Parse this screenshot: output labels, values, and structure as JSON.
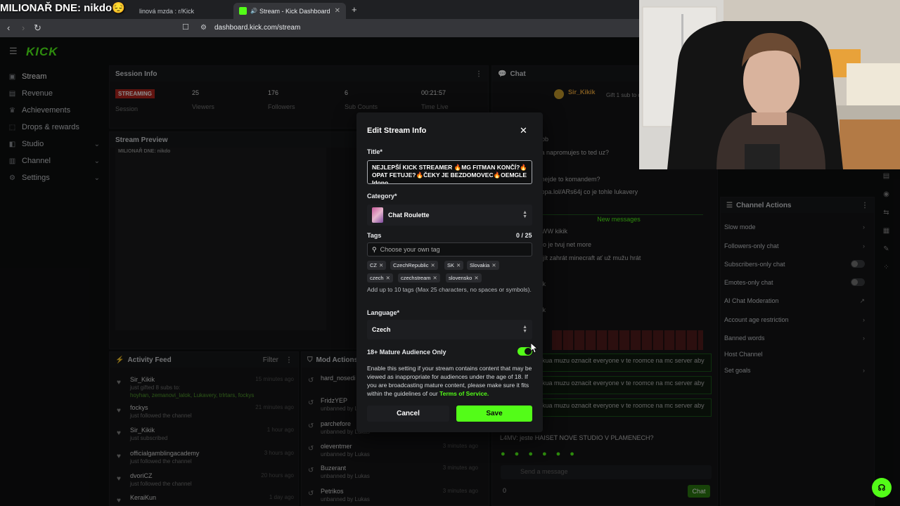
{
  "overlay_text": "MILIONAŘ DNE: nikdo😔",
  "browser": {
    "tabs": [
      {
        "label": "linová mzda : r/Kick",
        "active": false
      },
      {
        "label": "Stream - Kick Dashboard",
        "active": true
      }
    ],
    "new_tab": "+",
    "url": "dashboard.kick.com/stream"
  },
  "app": {
    "logo": "KICK",
    "nav": [
      {
        "label": "Stream",
        "icon": "stream-icon",
        "active": true,
        "expandable": false
      },
      {
        "label": "Revenue",
        "icon": "revenue-icon",
        "active": false,
        "expandable": false
      },
      {
        "label": "Achievements",
        "icon": "trophy-icon",
        "active": false,
        "expandable": false
      },
      {
        "label": "Drops & rewards",
        "icon": "gift-icon",
        "active": false,
        "expandable": false
      },
      {
        "label": "Studio",
        "icon": "studio-icon",
        "active": false,
        "expandable": true
      },
      {
        "label": "Channel",
        "icon": "channel-icon",
        "active": false,
        "expandable": true
      },
      {
        "label": "Settings",
        "icon": "gear-icon",
        "active": false,
        "expandable": true
      }
    ],
    "session_info": {
      "title": "Session Info",
      "badge": "STREAMING",
      "badge_label": "Session",
      "stats": [
        {
          "value": "25",
          "label": "Viewers"
        },
        {
          "value": "176",
          "label": "Followers"
        },
        {
          "value": "6",
          "label": "Sub Counts"
        },
        {
          "value": "00:21:57",
          "label": "Time Live"
        }
      ]
    },
    "stream_preview": {
      "title": "Stream Preview",
      "inner_title": "MILIONAŘ DNE: nikdo"
    },
    "activity_feed": {
      "title": "Activity Feed",
      "filter_label": "Filter",
      "items": [
        {
          "name": "Sir_Kikik",
          "sub": "just gifted 8 subs to:",
          "extra": "hoyhan, zemanovi_lalok, Lukavery, trlrtars, fockys",
          "time": "15 minutes ago"
        },
        {
          "name": "fockys",
          "sub": "just followed the channel",
          "time": "21 minutes ago"
        },
        {
          "name": "Sir_Kikik",
          "sub": "just subscribed",
          "time": "1 hour ago"
        },
        {
          "name": "officialgamblingacademy",
          "sub": "just followed the channel",
          "time": "3 hours ago"
        },
        {
          "name": "dvoriCZ",
          "sub": "just followed the channel",
          "time": "20 hours ago"
        },
        {
          "name": "KeraiKun",
          "sub": "",
          "time": "1 day ago"
        }
      ]
    },
    "mod_actions": {
      "title": "Mod Actions",
      "items": [
        {
          "name": "hard_nosedi",
          "sub": ""
        },
        {
          "name": "FridzYEP",
          "sub": "unbanned by Lukas"
        },
        {
          "name": "parchefore",
          "sub": "unbanned by Lukas"
        },
        {
          "name": "oleventmer",
          "sub": "unbanned by Lukas",
          "time": "3 minutes ago"
        },
        {
          "name": "Buzerant",
          "sub": "unbanned by Lukas",
          "time": "3 minutes ago"
        },
        {
          "name": "Petrikos",
          "sub": "unbanned by Lukas",
          "time": "3 minutes ago"
        }
      ]
    },
    "chat": {
      "title": "Chat",
      "pinned_user": "Sir_Kikik",
      "pinned_text": "Gift 1 sub to chat",
      "lines": [
        "e: bb",
        "kua napromujes to ted uz?",
        "dd",
        "k: nejde to komandem?",
        "kappa.lol/ARs64j co je tohle lukavery"
      ],
      "new_messages_label": "New messages",
      "lines2": [
        "e: WW kikik",
        "k: to je tvuj net more",
        "eš jít zahrát minecraft ať už mužu hrát",
        "od",
        "icek",
        "icek"
      ],
      "boxed": [
        "ukua muzu oznacit everyone v te roomce na mc server aby",
        "ukua muzu oznacit everyone v te roomce na mc server aby",
        "ukua muzu oznacit everyone v te roomce na mc server aby"
      ],
      "last_line": "L4MV: jeste HAISET NOVE STUDIO V PLAMENECH?",
      "input_placeholder": "Send a message",
      "send_label": "Chat",
      "count": "0"
    },
    "channel_actions": {
      "title": "Channel Actions",
      "items": [
        {
          "label": "Slow mode",
          "kind": "chevron"
        },
        {
          "label": "Followers-only chat",
          "kind": "chevron"
        },
        {
          "label": "Subscribers-only chat",
          "kind": "toggle"
        },
        {
          "label": "Emotes-only chat",
          "kind": "toggle"
        },
        {
          "label": "AI Chat Moderation",
          "kind": "external"
        },
        {
          "label": "Account age restriction",
          "kind": "chevron"
        },
        {
          "label": "Banned words",
          "kind": "chevron"
        },
        {
          "label": "Host Channel",
          "kind": "none"
        },
        {
          "label": "Set goals",
          "kind": "chevron"
        }
      ]
    }
  },
  "modal": {
    "title": "Edit Stream Info",
    "title_label": "Title*",
    "title_value": "NEJLEPŠÍ KICK STREAMER 🔥MG FITMAN KONČÍ?🔥OPAT FETUJE?🔥ČEKY JE BEZDOMOVEC🔥OEMGLE Idono",
    "category_label": "Category*",
    "category_value": "Chat Roulette",
    "tags_label": "Tags",
    "tag_count": "0 / 25",
    "tag_placeholder": "Choose your own tag",
    "tags": [
      "CZ",
      "CzechRepublic",
      "SK",
      "Slovakia",
      "czech",
      "czechstream",
      "slovensko"
    ],
    "tag_help": "Add up to 10 tags (Max 25 characters, no spaces or symbols).",
    "language_label": "Language*",
    "language_value": "Czech",
    "mature_label": "18+ Mature Audience Only",
    "mature_enabled": true,
    "mature_desc": "Enable this setting if your stream contains content that may be viewed as inappropriate for audiences under the age of 18. If you are broadcasting mature content, please make sure it fits within the guidelines of our",
    "mature_link": "Terms of Service.",
    "cancel_label": "Cancel",
    "save_label": "Save"
  },
  "colors": {
    "accent": "#53fc18",
    "live": "#b3261e",
    "background": "#0e0f10",
    "modal": "#18191b"
  }
}
